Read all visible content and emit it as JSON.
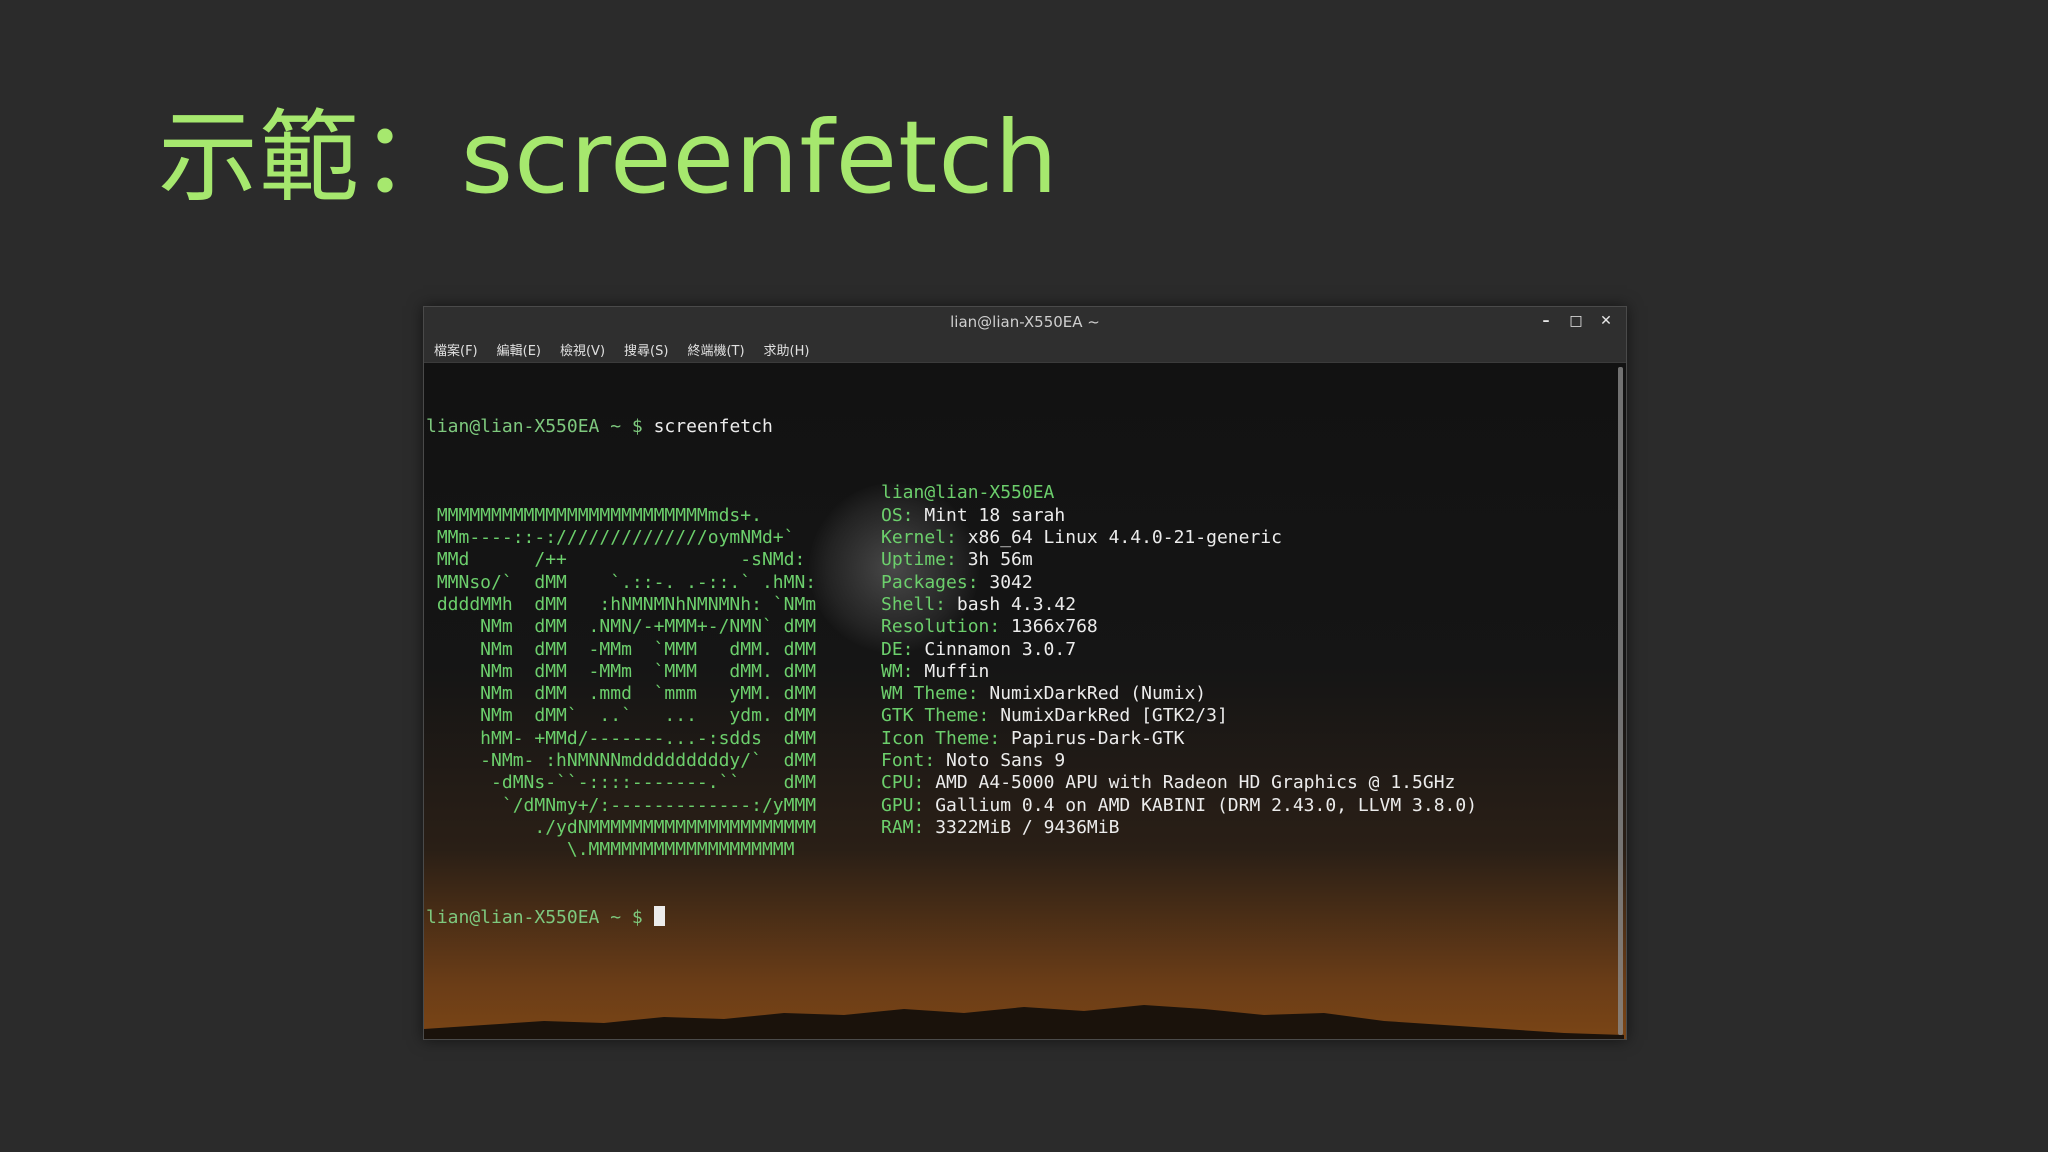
{
  "slide": {
    "title": "示範：screenfetch"
  },
  "window": {
    "title": "lian@lian-X550EA ~",
    "controls": {
      "minimize": "–",
      "maximize": "□",
      "close": "✕"
    },
    "menu": [
      "檔案(F)",
      "編輯(E)",
      "檢視(V)",
      "搜尋(S)",
      "終端機(T)",
      "求助(H)"
    ]
  },
  "terminal": {
    "prompt": "lian@lian-X550EA ~ $",
    "command": "screenfetch",
    "logo": [
      "",
      " MMMMMMMMMMMMMMMMMMMMMMMMMmds+.",
      " MMm----::-://////////////oymNMd+`",
      " MMd      /++                -sNMd:",
      " MMNso/`  dMM    `.::-. .-::.` .hMN:",
      " ddddMMh  dMM   :hNMNMNhNMNMNh: `NMm",
      "     NMm  dMM  .NMN/-+MMM+-/NMN` dMM",
      "     NMm  dMM  -MMm  `MMM   dMM. dMM",
      "     NMm  dMM  -MMm  `MMM   dMM. dMM",
      "     NMm  dMM  .mmd  `mmm   yMM. dMM",
      "     NMm  dMM`  ..`   ...   ydm. dMM",
      "     hMM- +MMd/-------...-:sdds  dMM",
      "     -NMm- :hNMNNNmdddddddddy/`  dMM",
      "      -dMNs-``-::::-------.``    dMM",
      "       `/dMNmy+/:-------------:/yMMM",
      "          ./ydNMMMMMMMMMMMMMMMMMMMMM",
      "             \\.MMMMMMMMMMMMMMMMMMM"
    ],
    "info": [
      {
        "key": "",
        "value": "lian@lian-X550EA"
      },
      {
        "key": "OS:",
        "value": " Mint 18 sarah"
      },
      {
        "key": "Kernel:",
        "value": " x86_64 Linux 4.4.0-21-generic"
      },
      {
        "key": "Uptime:",
        "value": " 3h 56m"
      },
      {
        "key": "Packages:",
        "value": " 3042"
      },
      {
        "key": "Shell:",
        "value": " bash 4.3.42"
      },
      {
        "key": "Resolution:",
        "value": " 1366x768"
      },
      {
        "key": "DE:",
        "value": " Cinnamon 3.0.7"
      },
      {
        "key": "WM:",
        "value": " Muffin"
      },
      {
        "key": "WM Theme:",
        "value": " NumixDarkRed (Numix)"
      },
      {
        "key": "GTK Theme:",
        "value": " NumixDarkRed [GTK2/3]"
      },
      {
        "key": "Icon Theme:",
        "value": " Papirus-Dark-GTK"
      },
      {
        "key": "Font:",
        "value": " Noto Sans 9"
      },
      {
        "key": "CPU:",
        "value": " AMD A4-5000 APU with Radeon HD Graphics @ 1.5GHz"
      },
      {
        "key": "GPU:",
        "value": " Gallium 0.4 on AMD KABINI (DRM 2.43.0, LLVM 3.8.0)"
      },
      {
        "key": "RAM:",
        "value": " 3322MiB / 9436MiB"
      },
      {
        "key": "",
        "value": ""
      }
    ]
  },
  "colors": {
    "accent": "#a6e86e",
    "terminal_green": "#6ccf6c"
  }
}
